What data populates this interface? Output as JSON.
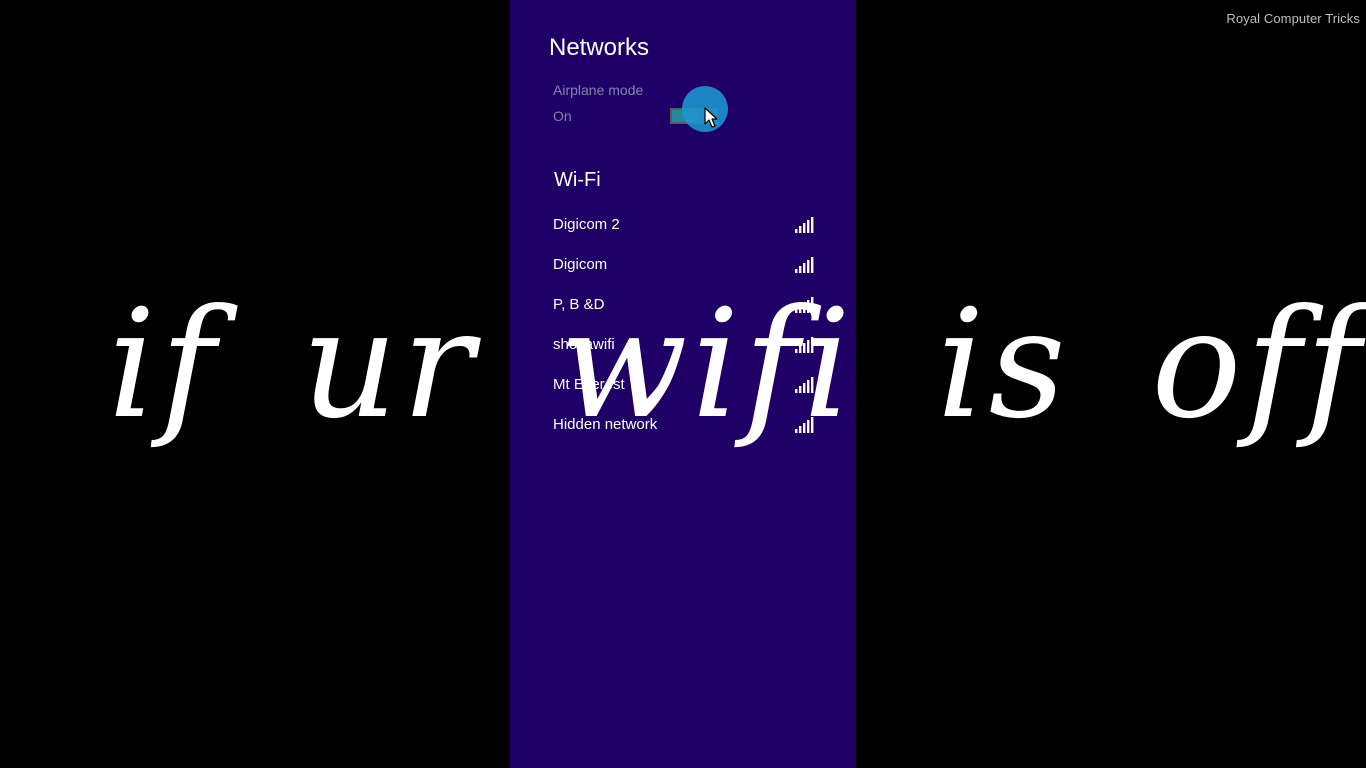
{
  "watermark": "Royal Computer Tricks",
  "panel": {
    "title": "Networks",
    "airplane": {
      "label": "Airplane mode",
      "state": "On",
      "toggle_on": true
    },
    "wifi": {
      "heading": "Wi-Fi",
      "networks": [
        {
          "name": "Digicom 2",
          "signal_icon": "wifi-signal-icon",
          "signal_bars": 5
        },
        {
          "name": "Digicom",
          "signal_icon": "wifi-signal-icon",
          "signal_bars": 5
        },
        {
          "name": "P, B &D",
          "signal_icon": "wifi-signal-icon",
          "signal_bars": 5
        },
        {
          "name": "shovawifi",
          "signal_icon": "wifi-signal-icon",
          "signal_bars": 5
        },
        {
          "name": "Mt Everest",
          "signal_icon": "wifi-signal-icon",
          "signal_bars": 5
        },
        {
          "name": "Hidden network",
          "signal_icon": "wifi-signal-icon",
          "signal_bars": 5
        }
      ]
    },
    "colors": {
      "panel_background": "#1f0067",
      "toggle_accent": "#1f8a9a",
      "click_indicator": "#1e96d2"
    }
  },
  "caption": "if ur wifi is off turn"
}
